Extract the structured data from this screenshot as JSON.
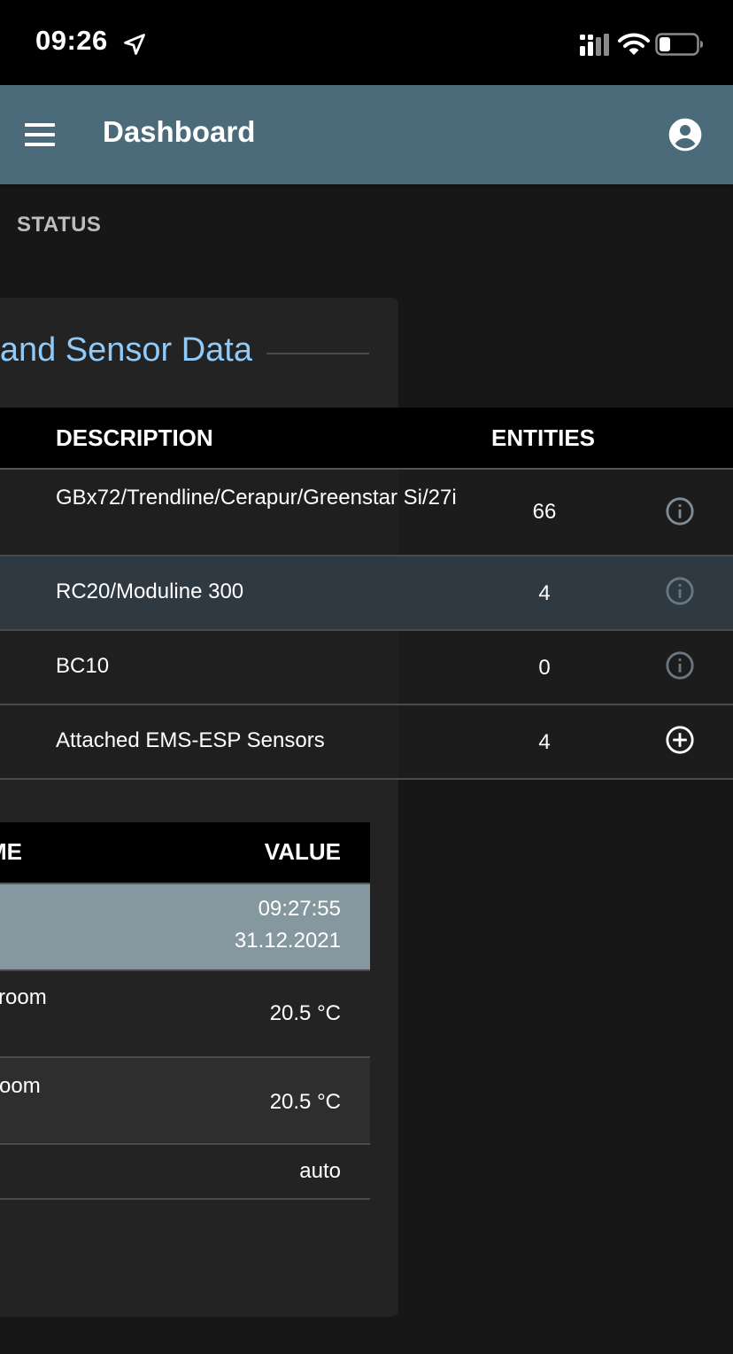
{
  "status_bar": {
    "time": "09:26",
    "icons": [
      "location-arrow-icon",
      "cellular-signal-icon",
      "wifi-icon",
      "battery-icon"
    ]
  },
  "app_bar": {
    "title": "Dashboard",
    "menu_icon": "hamburger-menu-icon",
    "account_icon": "account-circle-icon",
    "color": "#4b6b7a"
  },
  "tabs": [
    {
      "label": "STATUS"
    }
  ],
  "card": {
    "title": "and Sensor Data"
  },
  "devices_table": {
    "columns": {
      "description": "DESCRIPTION",
      "entities": "ENTITIES"
    },
    "rows": [
      {
        "description": "GBx72/Trendline/Cerapur/Greenstar Si/27i",
        "entities": "66",
        "action_icon": "info-icon"
      },
      {
        "description": "RC20/Moduline 300",
        "entities": "4",
        "action_icon": "info-icon",
        "selected": true
      },
      {
        "description": "BC10",
        "entities": "0",
        "action_icon": "info-icon"
      },
      {
        "description": "Attached EMS-ESP Sensors",
        "entities": "4",
        "action_icon": "add-circle-icon"
      }
    ]
  },
  "sensor_table": {
    "columns": {
      "name": "ME",
      "value": "VALUE"
    },
    "rows": [
      {
        "name": "",
        "value_line1": "09:27:55",
        "value_line2": "31.12.2021",
        "highlighted": true
      },
      {
        "name": "room",
        "value": "20.5 °C"
      },
      {
        "name": "oom",
        "value": "20.5 °C"
      },
      {
        "name": "",
        "value": "auto"
      }
    ]
  },
  "colors": {
    "background": "#171717",
    "card": "#232323",
    "accent_title": "#90caf9",
    "selected_row": "#2f3942",
    "highlight_row": "#86989f"
  }
}
